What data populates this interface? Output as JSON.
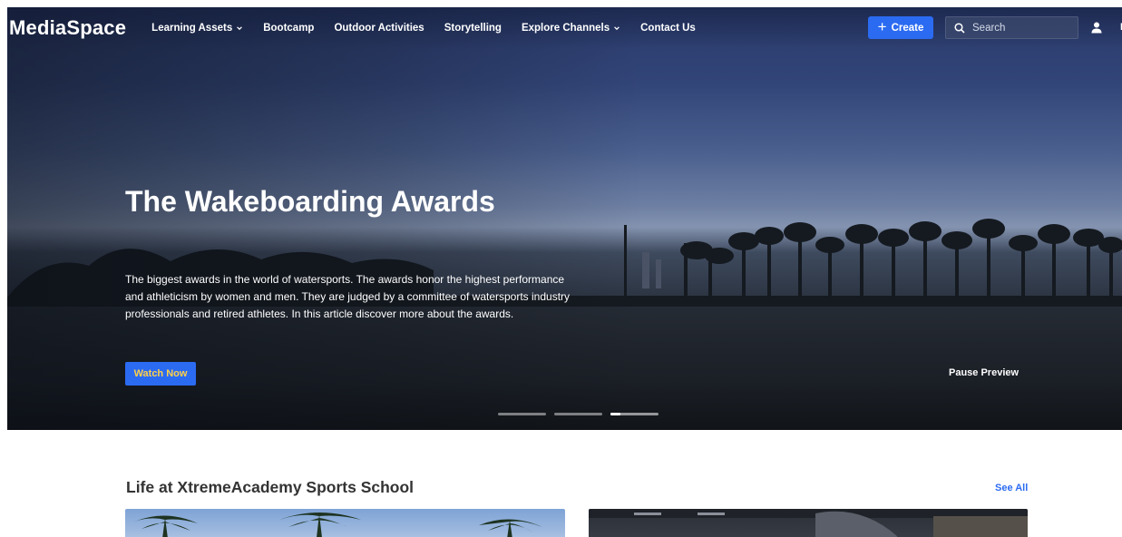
{
  "app": {
    "name": "MediaSpace"
  },
  "nav": {
    "items": [
      {
        "label": "Learning Assets",
        "dropdown": true
      },
      {
        "label": "Bootcamp",
        "dropdown": false
      },
      {
        "label": "Outdoor Activities",
        "dropdown": false
      },
      {
        "label": "Storytelling",
        "dropdown": false
      },
      {
        "label": "Explore Channels",
        "dropdown": true
      },
      {
        "label": "Contact Us",
        "dropdown": false
      }
    ],
    "create_label": "Create",
    "search_placeholder": "Search",
    "user_initial": "E"
  },
  "hero": {
    "title": "The Wakeboarding Awards",
    "description": "The biggest awards in the world of watersports. The awards honor the highest performance and athleticism by women and men. They are judged by a committee of watersports industry professionals and retired athletes. In this article discover more about the awards.",
    "cta_label": "Watch Now",
    "pause_label": "Pause Preview",
    "slide_count": 3,
    "active_slide": 3
  },
  "section": {
    "title": "Life at XtremeAcademy Sports School",
    "see_all_label": "See All"
  },
  "colors": {
    "accent": "#2b6bf2",
    "cta_text": "#ffd04a",
    "section_title": "#333333"
  }
}
